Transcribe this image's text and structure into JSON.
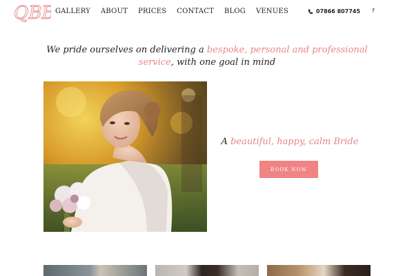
{
  "brand": {
    "logo_text": "QBB",
    "accent_color": "#e88585",
    "button_color": "#f08484"
  },
  "nav": {
    "items": [
      {
        "label": "GALLERY"
      },
      {
        "label": "ABOUT"
      },
      {
        "label": "PRICES"
      },
      {
        "label": "CONTACT"
      },
      {
        "label": "BLOG"
      },
      {
        "label": "VENUES"
      }
    ]
  },
  "contact": {
    "phone": "07866 807745",
    "phone_icon": "phone-icon",
    "social_icon": "facebook-icon",
    "social_text": "f"
  },
  "hero": {
    "headline_pre": "We pride ourselves on delivering a ",
    "headline_accent": "bespoke, personal and professional service",
    "headline_post": ", with one goal in mind",
    "tagline_pre": "A ",
    "tagline_accent": "beautiful, happy, calm Bride",
    "book_button": "BOOK NOW"
  }
}
